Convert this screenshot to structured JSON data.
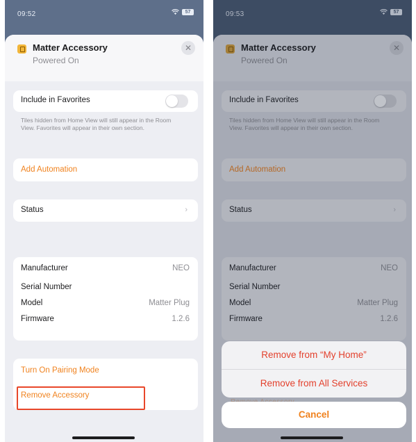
{
  "left": {
    "time": "09:52",
    "battery": "57",
    "title": "Matter Accessory",
    "subtitle": "Powered On",
    "favorites_label": "Include in Favorites",
    "favorites_note": "Tiles hidden from Home View will still appear in the Room View. Favorites will appear in their own section.",
    "add_automation": "Add Automation",
    "status_label": "Status",
    "info": [
      {
        "label": "Manufacturer",
        "value": "NEO"
      },
      {
        "label": "Serial Number",
        "value": ""
      },
      {
        "label": "Model",
        "value": "Matter Plug"
      },
      {
        "label": "Firmware",
        "value": "1.2.6"
      }
    ],
    "pairing_mode": "Turn On Pairing Mode",
    "remove_accessory": "Remove Accessory"
  },
  "right": {
    "time": "09:53",
    "battery": "57",
    "title": "Matter Accessory",
    "subtitle": "Powered On",
    "favorites_label": "Include in Favorites",
    "favorites_note": "Tiles hidden from Home View will still appear in the Room View. Favorites will appear in their own section.",
    "add_automation": "Add Automation",
    "status_label": "Status",
    "info": [
      {
        "label": "Manufacturer",
        "value": "NEO"
      },
      {
        "label": "Serial Number",
        "value": ""
      },
      {
        "label": "Model",
        "value": "Matter Plug"
      },
      {
        "label": "Firmware",
        "value": "1.2.6"
      }
    ],
    "peek_text": "Remove Accessory",
    "action_sheet": {
      "remove_home": "Remove from “My Home”",
      "remove_all": "Remove from All Services",
      "cancel": "Cancel"
    }
  },
  "colors": {
    "accent": "#f0821e",
    "destructive": "#e3402c",
    "highlight": "#e8472a"
  }
}
